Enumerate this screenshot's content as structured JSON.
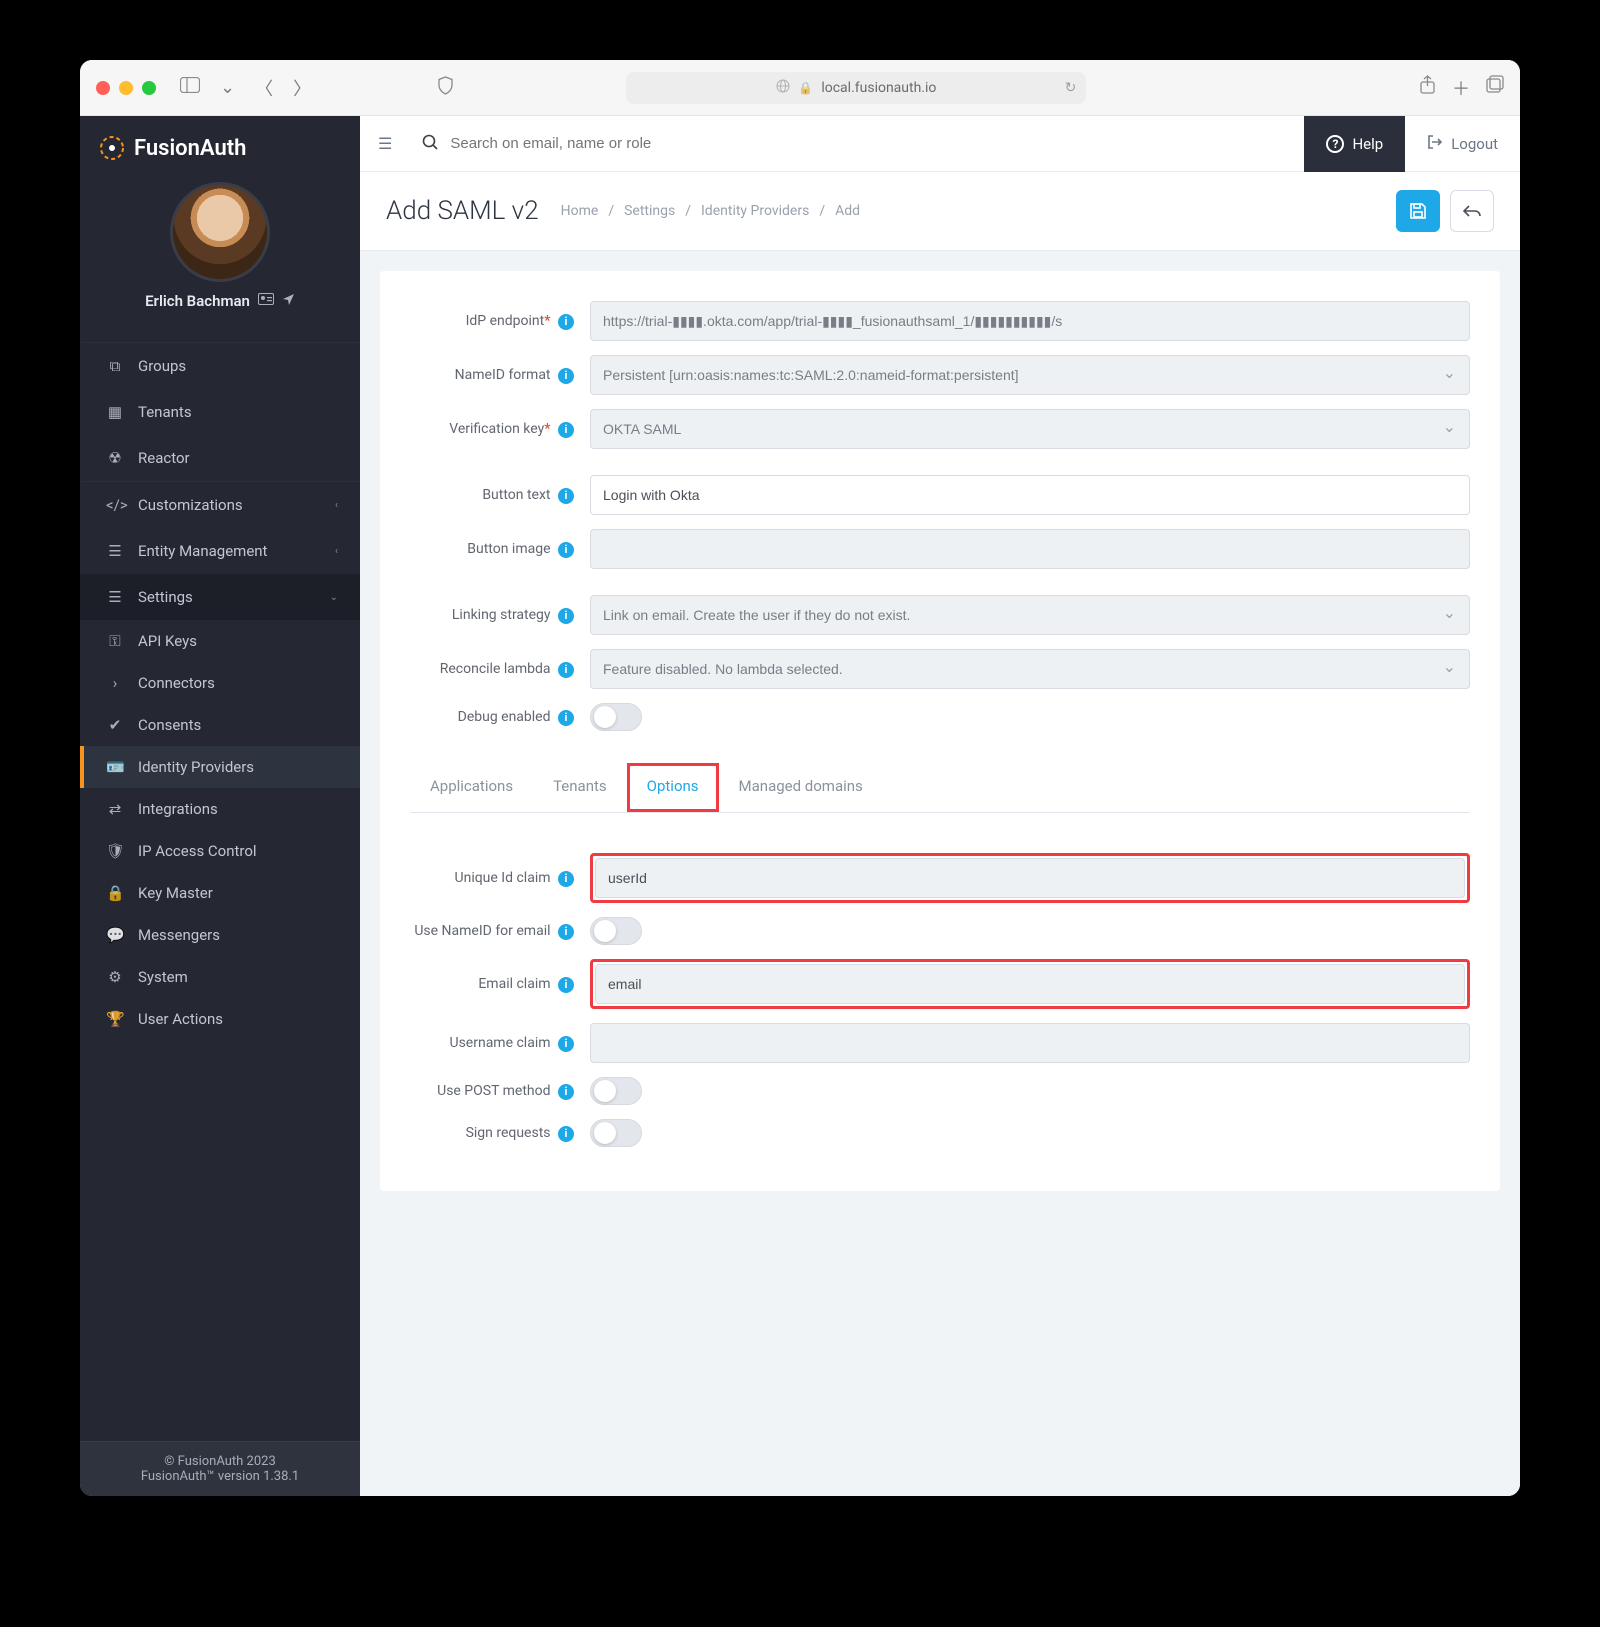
{
  "browser": {
    "url": "local.fusionauth.io"
  },
  "brand": {
    "name": "FusionAuth"
  },
  "user": {
    "name": "Erlich Bachman"
  },
  "sidebar": {
    "groups": "Groups",
    "tenants": "Tenants",
    "reactor": "Reactor",
    "customizations": "Customizations",
    "entity": "Entity Management",
    "settings": "Settings",
    "sub": {
      "api_keys": "API Keys",
      "connectors": "Connectors",
      "consents": "Consents",
      "idp": "Identity Providers",
      "integrations": "Integrations",
      "ip_access": "IP Access Control",
      "key_master": "Key Master",
      "messengers": "Messengers",
      "system": "System",
      "user_actions": "User Actions"
    }
  },
  "footer": {
    "copyright": "© FusionAuth 2023",
    "version": "FusionAuth™ version 1.38.1"
  },
  "topbar": {
    "search_placeholder": "Search on email, name or role",
    "help": "Help",
    "logout": "Logout"
  },
  "page": {
    "title": "Add SAML v2",
    "crumbs": [
      "Home",
      "Settings",
      "Identity Providers",
      "Add"
    ]
  },
  "form": {
    "idp_endpoint": {
      "label": "IdP endpoint",
      "value": "https://trial-▮▮▮▮.okta.com/app/trial-▮▮▮▮_fusionauthsaml_1/▮▮▮▮▮▮▮▮▮▮/s"
    },
    "nameid_format": {
      "label": "NameID format",
      "value": "Persistent [urn:oasis:names:tc:SAML:2.0:nameid-format:persistent]"
    },
    "verification_key": {
      "label": "Verification key",
      "value": "OKTA SAML"
    },
    "button_text": {
      "label": "Button text",
      "value": "Login with Okta"
    },
    "button_image": {
      "label": "Button image",
      "value": ""
    },
    "linking_strategy": {
      "label": "Linking strategy",
      "value": "Link on email. Create the user if they do not exist."
    },
    "reconcile_lambda": {
      "label": "Reconcile lambda",
      "value": "Feature disabled. No lambda selected."
    },
    "debug_enabled": {
      "label": "Debug enabled"
    },
    "tabs": {
      "applications": "Applications",
      "tenants": "Tenants",
      "options": "Options",
      "managed_domains": "Managed domains"
    },
    "unique_id_claim": {
      "label": "Unique Id claim",
      "value": "userId"
    },
    "use_nameid_email": {
      "label": "Use NameID for email"
    },
    "email_claim": {
      "label": "Email claim",
      "value": "email"
    },
    "username_claim": {
      "label": "Username claim",
      "value": ""
    },
    "use_post": {
      "label": "Use POST method"
    },
    "sign_requests": {
      "label": "Sign requests"
    }
  }
}
